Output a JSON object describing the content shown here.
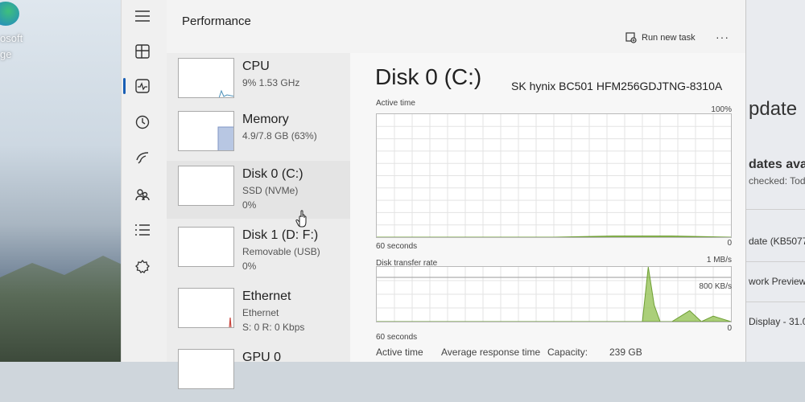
{
  "desktop": {
    "labels": [
      "osoft",
      "ge"
    ]
  },
  "window": {
    "title": "Performance",
    "run_new_task": "Run new task",
    "more": "···"
  },
  "devices": [
    {
      "name": "CPU",
      "line1": "9%  1.53 GHz",
      "line2": ""
    },
    {
      "name": "Memory",
      "line1": "4.9/7.8 GB (63%)",
      "line2": ""
    },
    {
      "name": "Disk 0 (C:)",
      "line1": "SSD (NVMe)",
      "line2": "0%"
    },
    {
      "name": "Disk 1 (D: F:)",
      "line1": "Removable (USB)",
      "line2": "0%"
    },
    {
      "name": "Ethernet",
      "line1": "Ethernet",
      "line2": "S: 0  R: 0 Kbps"
    },
    {
      "name": "GPU 0",
      "line1": "",
      "line2": ""
    }
  ],
  "detail": {
    "title": "Disk 0 (C:)",
    "model": "SK hynix BC501 HFM256GDJTNG-8310A",
    "chart1": {
      "label": "Active time",
      "max_label": "100%",
      "time_label": "60 seconds",
      "min_label": "0"
    },
    "chart2": {
      "label": "Disk transfer rate",
      "max_label": "1 MB/s",
      "mid_label": "800 KB/s",
      "time_label": "60 seconds",
      "min_label": "0"
    },
    "stats": {
      "active_time": "Active time",
      "avg_response": "Average response time",
      "capacity_label": "Capacity:",
      "capacity_value": "239 GB"
    }
  },
  "background_window": {
    "heading": "pdate",
    "updates": "dates avail",
    "checked": "checked: Tod",
    "item1": "date (KB5077",
    "item2": "work Preview",
    "item3": "Display - 31.0"
  },
  "chart_data": [
    {
      "type": "area",
      "title": "Active time",
      "xlabel": "60 seconds",
      "ylabel": "",
      "ylim": [
        0,
        100
      ],
      "x": [
        60,
        50,
        40,
        30,
        20,
        10,
        0
      ],
      "series": [
        {
          "values": [
            0,
            0,
            0,
            0,
            1,
            1,
            0
          ]
        }
      ]
    },
    {
      "type": "area",
      "title": "Disk transfer rate",
      "xlabel": "60 seconds",
      "ylabel": "",
      "ylim": [
        0,
        1
      ],
      "units": "MB/s",
      "x": [
        60,
        50,
        40,
        30,
        20,
        15,
        14,
        13,
        12,
        10,
        7,
        5,
        3,
        0
      ],
      "series": [
        {
          "values": [
            0,
            0,
            0,
            0,
            0,
            0,
            1,
            0.3,
            0,
            0,
            0.2,
            0,
            0.1,
            0
          ]
        }
      ]
    }
  ],
  "colors": {
    "accent": "#1a5fb4",
    "disk_graph": "#8fbf4c",
    "memory_graph": "#9fb3d6",
    "ethernet_graph": "#c8453d"
  }
}
